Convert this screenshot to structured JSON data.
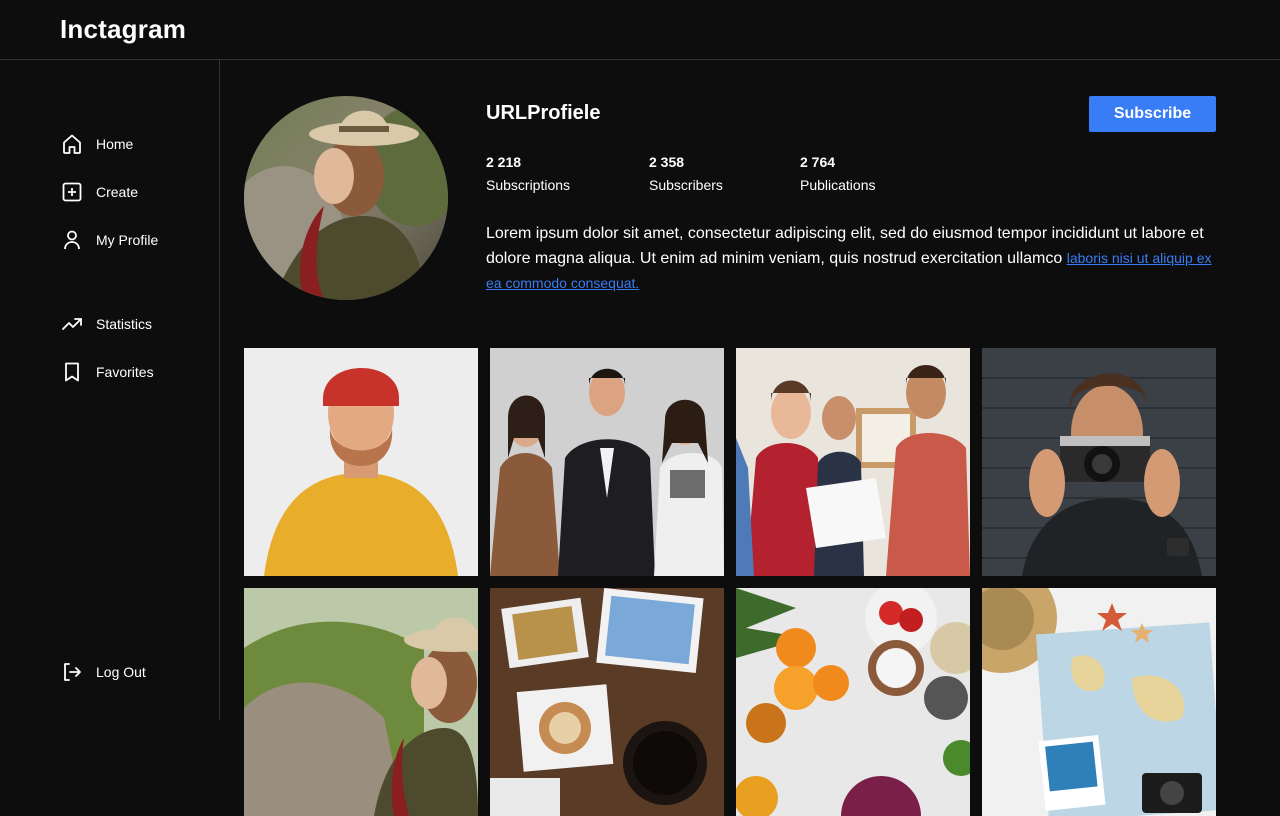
{
  "app": {
    "title": "Inctagram"
  },
  "sidebar": {
    "items": [
      {
        "label": "Home",
        "icon": "home-icon"
      },
      {
        "label": "Create",
        "icon": "plus-square-icon"
      },
      {
        "label": "My Profile",
        "icon": "person-icon"
      },
      {
        "label": "Statistics",
        "icon": "trending-up-icon"
      },
      {
        "label": "Favorites",
        "icon": "bookmark-icon"
      }
    ],
    "logout": {
      "label": "Log Out",
      "icon": "log-out-icon"
    }
  },
  "profile": {
    "username": "URLProfiele",
    "subscribe_label": "Subscribe",
    "stats": [
      {
        "value": "2 218",
        "label": "Subscriptions"
      },
      {
        "value": "2 358",
        "label": "Subscribers"
      },
      {
        "value": "2 764",
        "label": "Publications"
      }
    ],
    "bio": "Lorem ipsum dolor sit amet, consectetur adipiscing elit, sed do eiusmod tempor incididunt ut labore et dolore magna aliqua. Ut enim ad minim veniam, quis nostrud exercitation ullamco",
    "bio_link": "laboris nisi ut aliquip ex ea commodo consequat."
  },
  "colors": {
    "background": "#0d0d0d",
    "border": "#333333",
    "accent": "#397df6",
    "text": "#ffffff"
  }
}
